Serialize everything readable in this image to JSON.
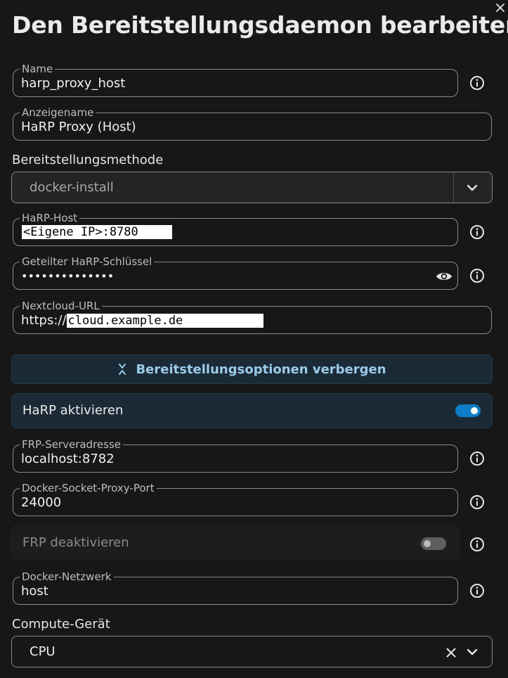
{
  "dialog": {
    "title": "Den Bereitstellungsdaemon bearbeiten"
  },
  "fields": {
    "name": {
      "label": "Name",
      "value": "harp_proxy_host"
    },
    "display_name": {
      "label": "Anzeigename",
      "value": "HaRP Proxy (Host)"
    },
    "harp_host": {
      "label": "HaRP-Host",
      "value": "<Eigene IP>:8780"
    },
    "shared_key": {
      "label": "Geteilter HaRP-Schlüssel",
      "value": "••••••••••••••"
    },
    "nextcloud_url": {
      "label": "Nextcloud-URL",
      "prefix": "https://",
      "value": "cloud.example.de"
    },
    "frp_server": {
      "label": "FRP-Serveradresse",
      "value": "localhost:8782"
    },
    "docker_socket_port": {
      "label": "Docker-Socket-Proxy-Port",
      "value": "24000"
    },
    "docker_network": {
      "label": "Docker-Netzwerk",
      "value": "host"
    }
  },
  "deploy_method": {
    "label": "Bereitstellungsmethode",
    "selected": "docker-install"
  },
  "options_toggle": {
    "label": "Bereitstellungsoptionen verbergen"
  },
  "switches": {
    "harp_enable": {
      "label": "HaRP aktivieren",
      "on": true
    },
    "frp_disable": {
      "label": "FRP deaktivieren",
      "on": false
    }
  },
  "compute_device": {
    "label": "Compute-Gerät",
    "selected": "CPU"
  },
  "colors": {
    "background": "#171717",
    "accent": "#0d7ec7",
    "accent_text": "#9ccbe9",
    "border": "#8a8a8a"
  },
  "icons": {
    "close": "close-icon",
    "info": "info-icon",
    "eye": "eye-icon",
    "chevron_down": "chevron-down-icon",
    "collapse": "collapse-icon",
    "clear": "clear-icon"
  }
}
